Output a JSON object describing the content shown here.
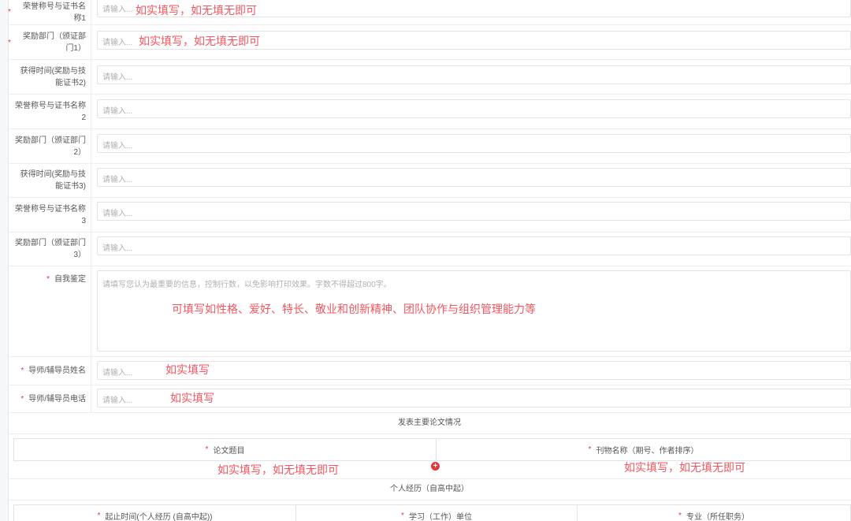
{
  "fields": [
    {
      "label": "荣誉称号与证书名称1",
      "required": true,
      "placeholder": "请输入...",
      "note": "如实填写，如无填无即可"
    },
    {
      "label": "奖励部门（颁证部门1）",
      "required": true,
      "placeholder": "请输入...",
      "note": "如实填写，如无填无即可"
    },
    {
      "label": "获得时间(奖励与技能证书2)",
      "required": false,
      "placeholder": "请输入..."
    },
    {
      "label": "荣誉称号与证书名称2",
      "required": false,
      "placeholder": "请输入..."
    },
    {
      "label": "奖励部门（颁证部门2）",
      "required": false,
      "placeholder": "请输入..."
    },
    {
      "label": "获得时间(奖励与技能证书3)",
      "required": false,
      "placeholder": "请输入..."
    },
    {
      "label": "荣誉称号与证书名称3",
      "required": false,
      "placeholder": "请输入..."
    },
    {
      "label": "奖励部门（颁证部门3）",
      "required": false,
      "placeholder": "请输入..."
    }
  ],
  "self_eval": {
    "label": "自我鉴定",
    "placeholder": "请填写您认为最重要的信息，控制行数，以免影响打印效果。字数不得超过800字。",
    "note": "可填写如性格、爱好、特长、敬业和创新精神、团队协作与组织管理能力等"
  },
  "tutor_name": {
    "label": "导师/辅导员姓名",
    "placeholder": "请输入...",
    "note": "如实填写"
  },
  "tutor_phone": {
    "label": "导师/辅导员电话",
    "placeholder": "请输入...",
    "note": "如实填写"
  },
  "papers": {
    "title": "发表主要论文情况",
    "col1": "论文题目",
    "col2": "刊物名称（期号、作者排序）",
    "note1": "如实填写，如无填无即可",
    "note2": "如实填写，如无填无即可",
    "add_icon": "plus-circle-icon"
  },
  "experience": {
    "title": "个人经历（自高中起）",
    "col1": "起止时间(个人经历 (自高中起))",
    "col2": "学习（工作）单位",
    "col3": "专业（所任职务）"
  },
  "colors": {
    "required": "#e4393c",
    "note": "#f2565f",
    "placeholder": "#b0b0b0"
  }
}
